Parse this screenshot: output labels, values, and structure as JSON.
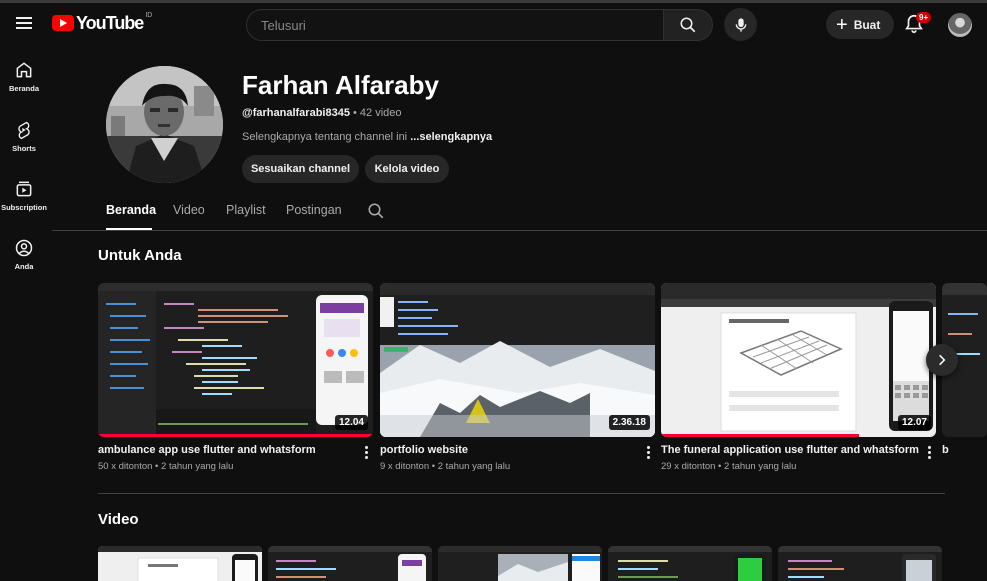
{
  "header": {
    "logo_text": "YouTube",
    "logo_region": "ID",
    "search_placeholder": "Telusuri",
    "create_label": "Buat",
    "notification_badge": "9+"
  },
  "sidebar": {
    "items": [
      {
        "label": "Beranda",
        "icon": "home-icon"
      },
      {
        "label": "Shorts",
        "icon": "shorts-icon"
      },
      {
        "label": "Subscription",
        "icon": "subscriptions-icon"
      },
      {
        "label": "Anda",
        "icon": "you-icon"
      }
    ]
  },
  "channel": {
    "name": "Farhan Alfaraby",
    "handle": "@farhanalfarabi8345",
    "separator": " • ",
    "video_count": "42 video",
    "about_text": "Selengkapnya tentang channel ini ",
    "about_more": "...selengkapnya",
    "customize_label": "Sesuaikan channel",
    "manage_label": "Kelola video"
  },
  "tabs": [
    {
      "label": "Beranda",
      "active": true
    },
    {
      "label": "Video",
      "active": false
    },
    {
      "label": "Playlist",
      "active": false
    },
    {
      "label": "Postingan",
      "active": false
    }
  ],
  "for_you": {
    "title": "Untuk Anda",
    "videos": [
      {
        "title": "ambulance app use flutter and whatsform",
        "views": "50 x ditonton",
        "age": "2 tahun yang lalu",
        "duration": "12.04",
        "watched_fraction": 1.0
      },
      {
        "title": "portfolio website",
        "views": "9 x ditonton",
        "age": "2 tahun yang lalu",
        "duration": "2.36.18",
        "watched_fraction": 0.0
      },
      {
        "title": "The funeral application use flutter and whatsform",
        "views": "29 x ditonton",
        "age": "2 tahun yang lalu",
        "duration": "12.07",
        "watched_fraction": 0.72
      }
    ],
    "partial_next_title": "b"
  },
  "videos_section": {
    "title": "Video"
  },
  "colors": {
    "background": "#0f0f0f",
    "accent_red": "#ff0000",
    "progress_red": "#ff0033",
    "chip_bg": "#272727",
    "muted_text": "#aaaaaa"
  }
}
